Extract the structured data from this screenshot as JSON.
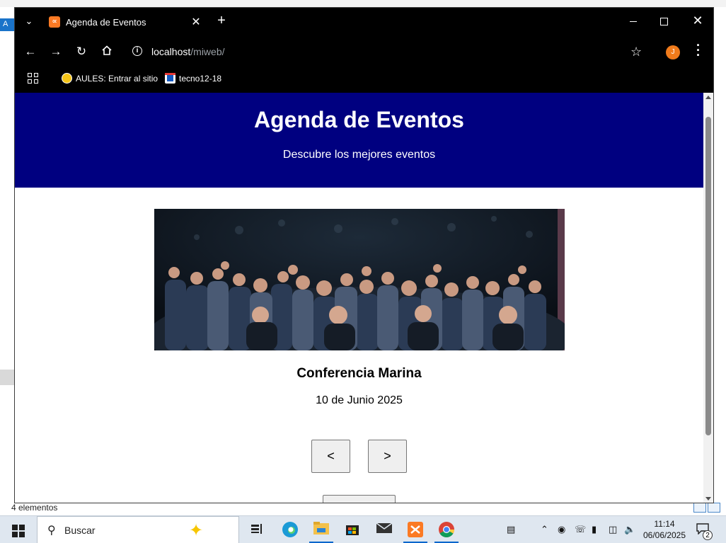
{
  "background_window": {
    "sidebar_letter": "A",
    "status_text": "4 elementos"
  },
  "browser": {
    "tab": {
      "title": "Agenda de Eventos",
      "favicon": "xampp-icon"
    },
    "url_host": "localhost",
    "url_path": "/miweb/",
    "profile_initial": "J",
    "bookmarks": [
      {
        "label": "AULES: Entrar al sitio",
        "icon": "aules-icon"
      },
      {
        "label": "tecno12-18",
        "icon": "tecno-icon"
      }
    ]
  },
  "page": {
    "header": {
      "title": "Agenda de Eventos",
      "subtitle": "Descubre los mejores eventos",
      "background_color": "#000080"
    },
    "event": {
      "image": "conference-audience-photo",
      "name": "Conferencia Marina",
      "date": "10 de Junio 2025"
    },
    "controls": {
      "prev_label": "<",
      "next_label": ">"
    }
  },
  "taskbar": {
    "search_placeholder": "Buscar",
    "clock_time": "11:14",
    "clock_date": "06/06/2025",
    "notification_count": "2"
  }
}
